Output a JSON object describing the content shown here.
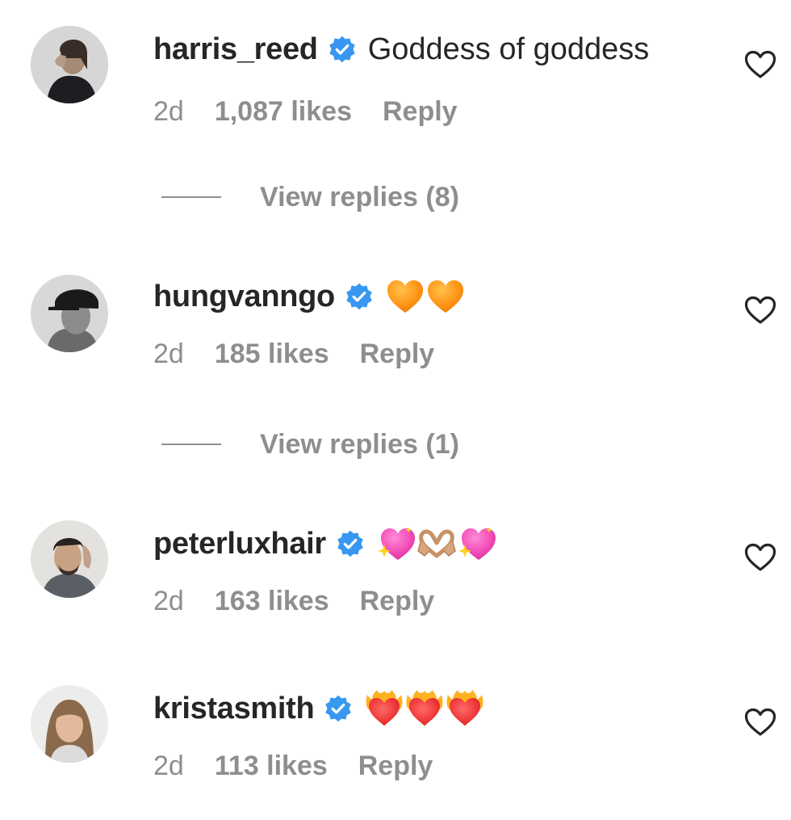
{
  "comments": [
    {
      "username": "harris_reed",
      "verified": true,
      "text": "Goddess of goddess",
      "emojis": [],
      "time": "2d",
      "likes": "1,087 likes",
      "reply_label": "Reply",
      "avatar": "woman-hand-at-face",
      "view_replies": "View replies (8)"
    },
    {
      "username": "hungvanngo",
      "verified": true,
      "text": "",
      "emojis": [
        "orange-heart",
        "orange-heart"
      ],
      "time": "2d",
      "likes": "185 likes",
      "reply_label": "Reply",
      "avatar": "man-cap-profile-bw",
      "view_replies": "View replies (1)"
    },
    {
      "username": "peterluxhair",
      "verified": true,
      "text": "",
      "emojis": [
        "sparkling-heart",
        "heart-hands",
        "sparkling-heart"
      ],
      "time": "2d",
      "likes": "163 likes",
      "reply_label": "Reply",
      "avatar": "man-dark-hair"
    },
    {
      "username": "kristasmith",
      "verified": true,
      "text": "",
      "emojis": [
        "heart-on-fire",
        "heart-on-fire",
        "heart-on-fire"
      ],
      "time": "2d",
      "likes": "113 likes",
      "reply_label": "Reply",
      "avatar": "woman-long-hair"
    }
  ],
  "colors": {
    "text": "#262626",
    "secondary": "#8e8e8e",
    "verified": "#3897f0"
  }
}
